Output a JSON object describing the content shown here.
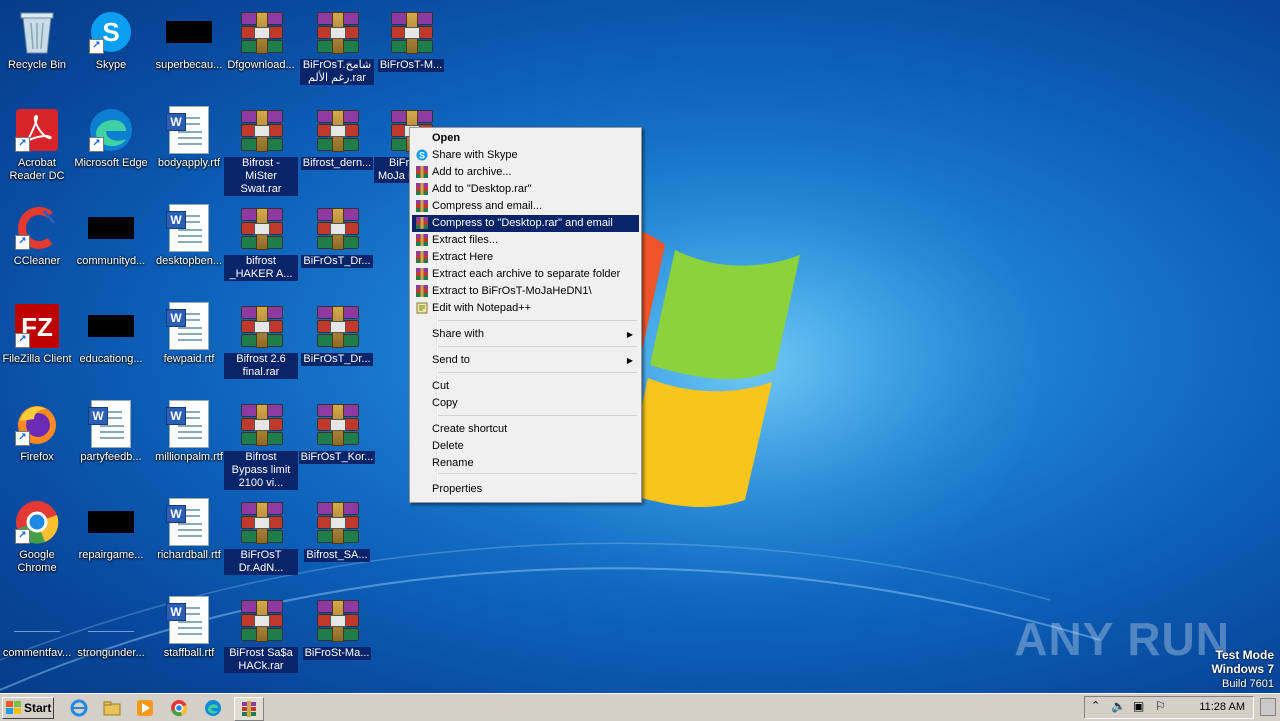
{
  "desktop": {
    "icons": [
      {
        "label": "Recycle Bin",
        "type": "recycle"
      },
      {
        "label": "Skype",
        "type": "skype"
      },
      {
        "label": "superbecau...",
        "type": "black"
      },
      {
        "label": "Dfgownload...",
        "type": "rar"
      },
      {
        "label": "BiFrOsT.شامخ رغم الألم.rar",
        "type": "rar"
      },
      {
        "label": "BiFrOsT-M...",
        "type": "rar"
      },
      {
        "label": "Acrobat Reader DC",
        "type": "acrobat"
      },
      {
        "label": "Microsoft Edge",
        "type": "edge"
      },
      {
        "label": "bodyapply.rtf",
        "type": "doc"
      },
      {
        "label": "Bifrost - MiSter Swat.rar",
        "type": "rar"
      },
      {
        "label": "Bifrost_dern...",
        "type": "rar"
      },
      {
        "label": "BiFrOsT-MoJa HeDN1",
        "type": "rar"
      },
      {
        "label": "CCleaner",
        "type": "ccleaner"
      },
      {
        "label": "communityd...",
        "type": "black"
      },
      {
        "label": "desktopben...",
        "type": "doc"
      },
      {
        "label": "bifrost _HAKER A...",
        "type": "rar"
      },
      {
        "label": "BiFrOsT_Dr...",
        "type": "rar"
      },
      {
        "label": "FileZilla Client",
        "type": "filezilla"
      },
      {
        "label": "educationg...",
        "type": "black"
      },
      {
        "label": "fewpaid.rtf",
        "type": "doc"
      },
      {
        "label": "Bifrost 2.6 final.rar",
        "type": "rar"
      },
      {
        "label": "BiFrOsT_Dr...",
        "type": "rar"
      },
      {
        "label": "Firefox",
        "type": "firefox"
      },
      {
        "label": "partyfeedb...",
        "type": "doc"
      },
      {
        "label": "millionpalm.rtf",
        "type": "doc"
      },
      {
        "label": "Bifrost Bypass limit 2100 vi...",
        "type": "rar"
      },
      {
        "label": "BiFrOsT_Kor...",
        "type": "rar"
      },
      {
        "label": "Google Chrome",
        "type": "chrome"
      },
      {
        "label": "repairgame...",
        "type": "black"
      },
      {
        "label": "richardball.rtf",
        "type": "doc"
      },
      {
        "label": "BiFrOsT Dr.AdN...",
        "type": "rar"
      },
      {
        "label": "Bifrost_SA...",
        "type": "rar"
      },
      {
        "label": "commentfav...",
        "type": "blank"
      },
      {
        "label": "strongunder...",
        "type": "blank"
      },
      {
        "label": "staffball.rtf",
        "type": "doc"
      },
      {
        "label": "BiFrost Sa$a HACk.rar",
        "type": "rar"
      },
      {
        "label": "BiFroSt-Ma...",
        "type": "rar"
      }
    ]
  },
  "context_menu": {
    "items": [
      {
        "label": "Open",
        "icon": "",
        "bold": true
      },
      {
        "label": "Share with Skype",
        "icon": "skype-icon"
      },
      {
        "label": "Add to archive...",
        "icon": "winrar-icon"
      },
      {
        "label": "Add to \"Desktop.rar\"",
        "icon": "winrar-icon"
      },
      {
        "label": "Compress and email...",
        "icon": "winrar-icon"
      },
      {
        "label": "Compress to \"Desktop.rar\" and email",
        "icon": "winrar-icon",
        "highlighted": true
      },
      {
        "label": "Extract files...",
        "icon": "winrar-icon"
      },
      {
        "label": "Extract Here",
        "icon": "winrar-icon"
      },
      {
        "label": "Extract each archive to separate folder",
        "icon": "winrar-icon"
      },
      {
        "label": "Extract to BiFrOsT-MoJaHeDN1\\",
        "icon": "winrar-icon"
      },
      {
        "label": "Edit with Notepad++",
        "icon": "notepad-icon"
      },
      {
        "label": "Share with",
        "submenu": true
      },
      {
        "label": "Send to",
        "submenu": true
      },
      {
        "label": "Cut"
      },
      {
        "label": "Copy"
      },
      {
        "label": "Create shortcut"
      },
      {
        "label": "Delete"
      },
      {
        "label": "Rename"
      },
      {
        "label": "Properties"
      }
    ]
  },
  "taskbar": {
    "start_label": "Start",
    "clock": "11:28 AM",
    "pinned": [
      "ie-icon",
      "explorer-icon",
      "media-player-icon",
      "chrome-icon",
      "edge-icon",
      "winrar-icon"
    ]
  },
  "watermark": {
    "brand": "ANY RUN",
    "mode": "Test Mode",
    "os": "Windows 7",
    "build": "Build 7601"
  },
  "colors": {
    "selection": "#0a246a",
    "taskbar": "#d4d0c8",
    "desktop": "#0c5fb8"
  }
}
